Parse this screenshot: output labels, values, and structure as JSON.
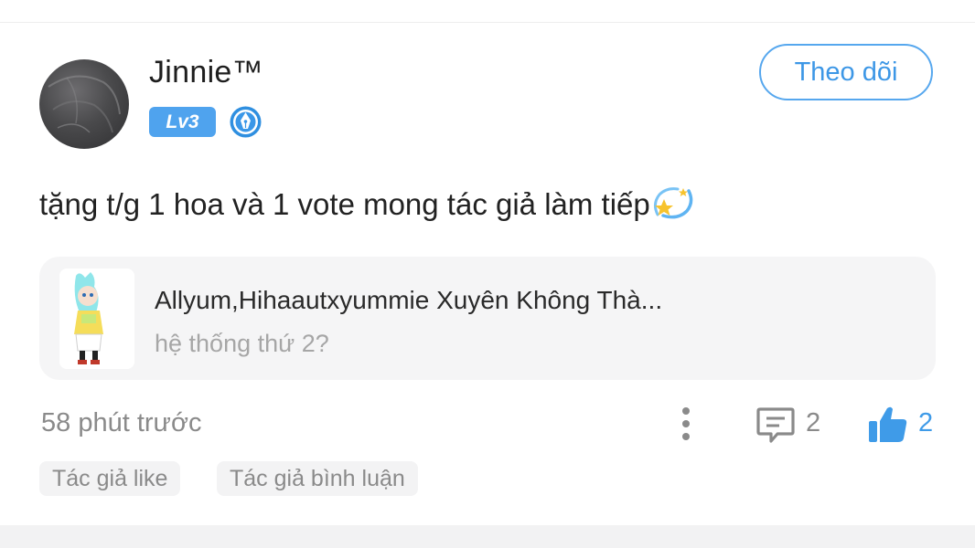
{
  "user": {
    "name": "Jinnie™",
    "level": "Lv3",
    "follow_label": "Theo dõi"
  },
  "comment": {
    "text": "tặng t/g 1 hoa và 1 vote mong tác giả làm tiếp",
    "emoji": "dizzy-star-emoji"
  },
  "book": {
    "title": "Allyum,Hihaautxyummie Xuyên Không Thà...",
    "subtitle": "hệ thống thứ 2?"
  },
  "meta": {
    "timestamp": "58 phút trước",
    "reply_count": "2",
    "like_count": "2"
  },
  "tags": [
    "Tác giả like",
    "Tác giả bình luận"
  ],
  "colors": {
    "accent": "#4fa3ee",
    "muted_text": "#8a8a8a",
    "card_bg": "#f5f5f6"
  }
}
